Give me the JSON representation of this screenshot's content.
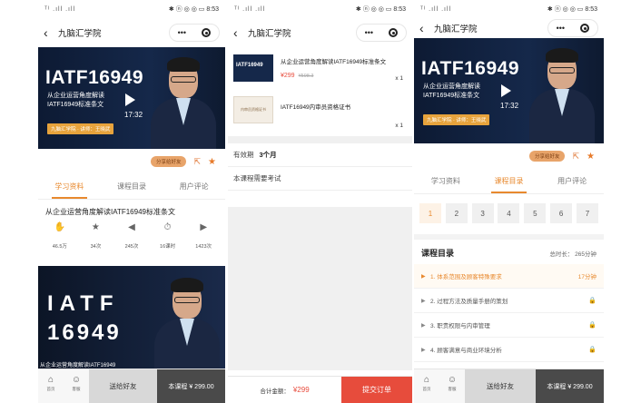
{
  "status": {
    "signal": "ᵀᴵ .ıll .ıll",
    "icons": "✱ ⓝ ◎ ◎",
    "battery": "▭",
    "time": "8:53"
  },
  "nav": {
    "title": "九脑汇学院",
    "back": "‹",
    "more": "•••"
  },
  "video": {
    "big_title": "IATF16949",
    "subtitle": "从企业运营角度解读IATF16949标准条文",
    "tagline": "九脑汇学院 · 讲师：王晓武",
    "duration": "17:32"
  },
  "share": {
    "label": "分享给好友"
  },
  "tabs": [
    "学习资料",
    "课程目录",
    "用户评论"
  ],
  "course": {
    "title": "从企业运营角度解读IATF16949标准条文"
  },
  "stats": [
    {
      "icon": "like-icon",
      "glyph": "✋",
      "value": "46.5万"
    },
    {
      "icon": "star-icon",
      "glyph": "★",
      "value": "34次"
    },
    {
      "icon": "share-icon",
      "glyph": "◀",
      "value": "245次"
    },
    {
      "icon": "clock-icon",
      "glyph": "⏱",
      "value": "16课时"
    },
    {
      "icon": "play-icon",
      "glyph": "▶",
      "value": "1423次"
    }
  ],
  "poster": {
    "line1": "IATF",
    "line2": "16949",
    "caption": "从企业运营角度解读IATF16949"
  },
  "bottom": {
    "home": "首页",
    "service": "客服",
    "share": "送给好友",
    "buy": "本课程 ¥ 299.00"
  },
  "order": {
    "items": [
      {
        "title": "从企业运营角度解读IATF16949标准条文",
        "price": "¥299",
        "old": "¥598.3",
        "qty": "x 1",
        "thumb": "IATF16949"
      },
      {
        "title": "IATF16949内审员资格证书",
        "qty": "x 1",
        "thumb": "内审员资格证书"
      }
    ],
    "validity_label": "有效期",
    "validity": "3个月",
    "exam_note": "本课程需要考试",
    "total_label": "合计金额：",
    "total": "¥299",
    "submit": "提交订单"
  },
  "catalog": {
    "pages": [
      "1",
      "2",
      "3",
      "4",
      "5",
      "6",
      "7"
    ],
    "title": "课程目录",
    "duration": "总时长： 265分钟",
    "lessons": [
      {
        "title": "1. 体系范围及顾客特殊要求",
        "right": "17分钟"
      },
      {
        "title": "2. 过程方法及质量手册的策划",
        "right": "🔒"
      },
      {
        "title": "3. 职责权限与内审管理",
        "right": "🔒"
      },
      {
        "title": "4. 顾客满意与商业环境分析",
        "right": "🔒"
      }
    ]
  }
}
